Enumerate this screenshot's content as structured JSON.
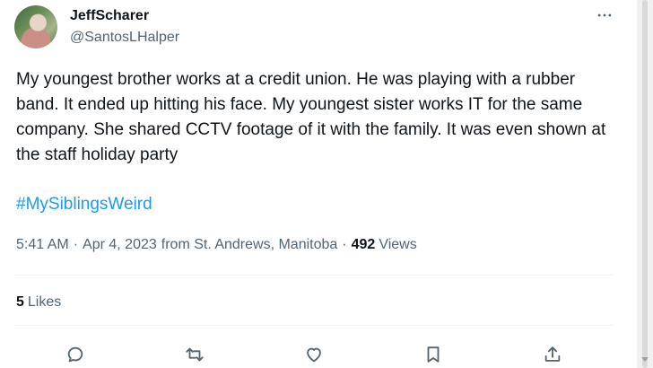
{
  "author": {
    "name": "JeffScharer",
    "handle": "@SantosLHalper"
  },
  "tweet": {
    "text": "My youngest brother works at a credit union.  He was playing with a rubber band.  It ended up hitting his face.  My youngest sister works IT for the same company.  She shared CCTV footage of it with the family.  It was even shown at the staff holiday party",
    "hashtag": "#MySiblingsWeird"
  },
  "meta": {
    "time": "5:41 AM",
    "date": "Apr 4, 2023",
    "location": "from St. Andrews, Manitoba",
    "views_count": "492",
    "views_label": "Views",
    "separator": "·"
  },
  "stats": {
    "likes_count": "5",
    "likes_label": "Likes"
  },
  "icons": {
    "more": "more-horizontal-icon",
    "reply": "reply-icon",
    "retweet": "retweet-icon",
    "like": "heart-icon",
    "bookmark": "bookmark-icon",
    "share": "share-icon"
  },
  "colors": {
    "text": "#0f1419",
    "secondary": "#536471",
    "link": "#1d9bf0",
    "divider": "#eff3f4"
  }
}
